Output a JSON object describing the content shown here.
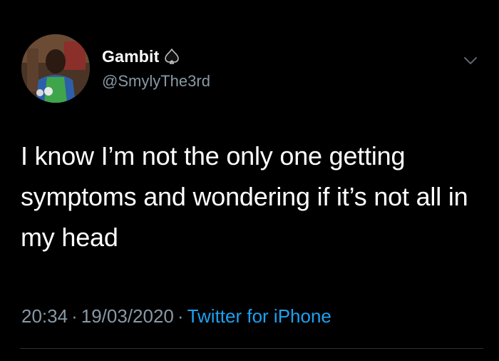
{
  "tweet": {
    "author": {
      "display_name": "Gambit",
      "handle": "@SmylyThe3rd",
      "badge_icon": "spade-icon",
      "avatar_icon": "avatar"
    },
    "text": "I know I’m not the only one getting symptoms and wondering if it’s not all in my head",
    "time": "20:34",
    "separator": "·",
    "date": "19/03/2020",
    "source": "Twitter for iPhone",
    "menu_icon": "chevron-down-icon"
  },
  "colors": {
    "background": "#000000",
    "text": "#ffffff",
    "secondary_text": "#8899a6",
    "link": "#1da1f2",
    "divider": "#2f3336"
  }
}
